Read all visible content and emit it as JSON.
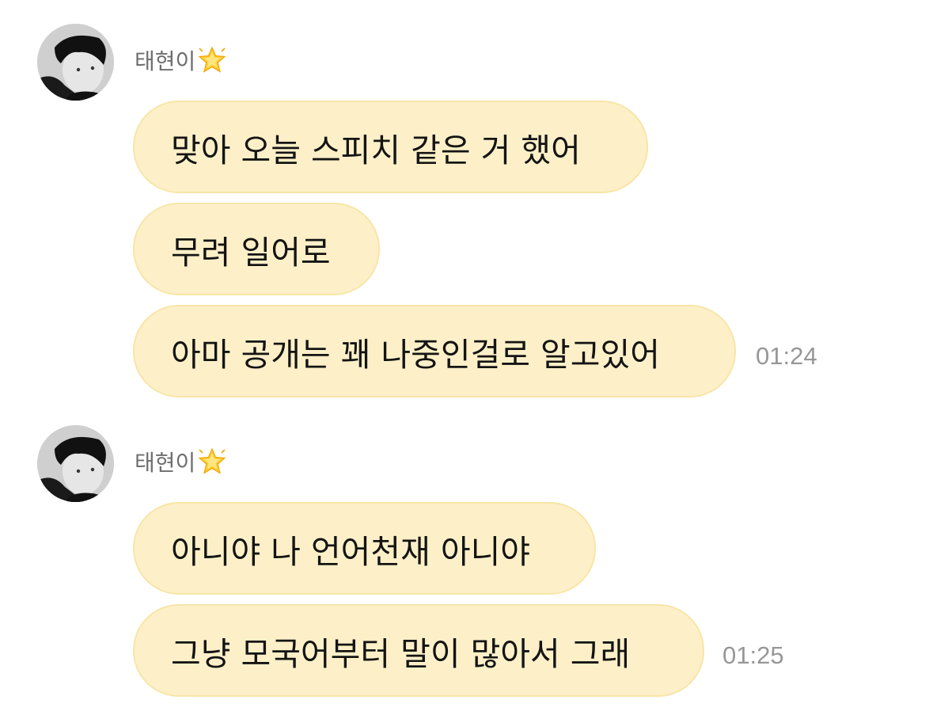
{
  "colors": {
    "bubble_bg": "#fdf0c8",
    "bubble_border": "#f8e5a8",
    "sender_text": "#6e6e6e",
    "time_text": "#979797"
  },
  "groups": [
    {
      "sender": "태현이",
      "sender_badge_icon": "glowing-star-icon",
      "messages": [
        "맞아 오늘 스피치 같은 거 했어",
        "무려 일어로",
        "아마 공개는 꽤 나중인걸로 알고있어"
      ],
      "time": "01:24"
    },
    {
      "sender": "태현이",
      "sender_badge_icon": "glowing-star-icon",
      "messages": [
        "아니야 나 언어천재 아니야",
        "그냥 모국어부터 말이 많아서 그래"
      ],
      "time": "01:25"
    }
  ]
}
